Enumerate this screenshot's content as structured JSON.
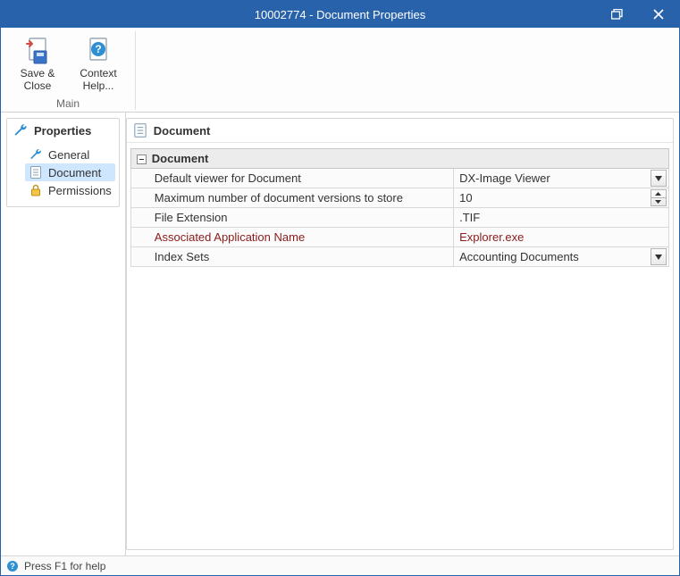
{
  "titlebar": {
    "title": "10002774 - Document Properties"
  },
  "ribbon": {
    "group_label": "Main",
    "save_close": "Save &\nClose",
    "context_help": "Context\nHelp..."
  },
  "sidebar": {
    "header": "Properties",
    "items": [
      {
        "label": "General"
      },
      {
        "label": "Document"
      },
      {
        "label": "Permissions"
      }
    ]
  },
  "grid": {
    "section_title": "Document",
    "category": "Document",
    "rows": [
      {
        "name": "Default viewer for Document",
        "value": "DX-Image Viewer",
        "editor": "dropdown"
      },
      {
        "name": "Maximum number of document versions to store",
        "value": "10",
        "editor": "spinner"
      },
      {
        "name": "File Extension",
        "value": ".TIF",
        "editor": "text"
      },
      {
        "name": "Associated Application Name",
        "value": "Explorer.exe",
        "editor": "text",
        "highlight": true
      },
      {
        "name": "Index Sets",
        "value": "Accounting Documents",
        "editor": "dropdown"
      }
    ]
  },
  "statusbar": {
    "hint": "Press F1 for help"
  }
}
